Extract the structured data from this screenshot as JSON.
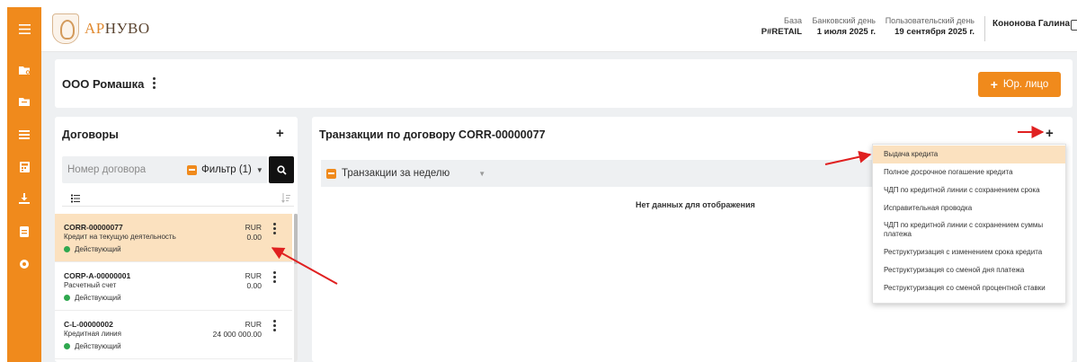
{
  "brand": {
    "logo_text_accent": "АР",
    "logo_text_rest": "НУВО"
  },
  "header": {
    "base_label": "База",
    "base_value": "P#RETAIL",
    "bank_day_label": "Банковский день",
    "bank_day_value": "1 июля 2025 г.",
    "user_day_label": "Пользовательский день",
    "user_day_value": "19 сентября 2025 г.",
    "user_name": "Кононова Галина"
  },
  "company": {
    "name": "ООО Ромашка",
    "add_legal_label": "Юр. лицо"
  },
  "contracts": {
    "title": "Договоры",
    "search_placeholder": "Номер договора",
    "filter_label": "Фильтр (1)",
    "items": [
      {
        "id": "CORR-00000077",
        "desc": "Кредит на текущую деятельность",
        "currency": "RUR",
        "amount": "0.00",
        "status": "Действующий",
        "active": true
      },
      {
        "id": "CORP-A-00000001",
        "desc": "Расчетный счет",
        "currency": "RUR",
        "amount": "0.00",
        "status": "Действующий",
        "active": false
      },
      {
        "id": "C-L-00000002",
        "desc": "Кредитная линия",
        "currency": "RUR",
        "amount": "24 000 000.00",
        "status": "Действующий",
        "active": false
      }
    ]
  },
  "transactions": {
    "title": "Транзакции по договору CORR-00000077",
    "period_label": "Транзакции за неделю",
    "empty_message": "Нет данных для отображения"
  },
  "add_menu": {
    "items": [
      "Выдача кредита",
      "Полное досрочное погашение кредита",
      "ЧДП по кредитной линии с сохранением срока",
      "Исправительная проводка",
      "ЧДП по кредитной линии с сохранением суммы платежа",
      "Реструктуризация с изменением срока кредита",
      "Реструктуризация со сменой дня платежа",
      "Реструктуризация со сменой процентной ставки"
    ],
    "highlighted_index": 0
  },
  "colors": {
    "accent": "#f08a1c",
    "highlight": "#fbe1bf",
    "status_active": "#2fa84f",
    "annotation": "#e02020"
  },
  "icons": {
    "rail": [
      "menu-icon",
      "folder-gear-icon",
      "folder-icon",
      "list-icon",
      "calculator-icon",
      "download-icon",
      "document-icon",
      "settings-icon"
    ],
    "search": "search-icon",
    "logout": "logout-icon"
  }
}
